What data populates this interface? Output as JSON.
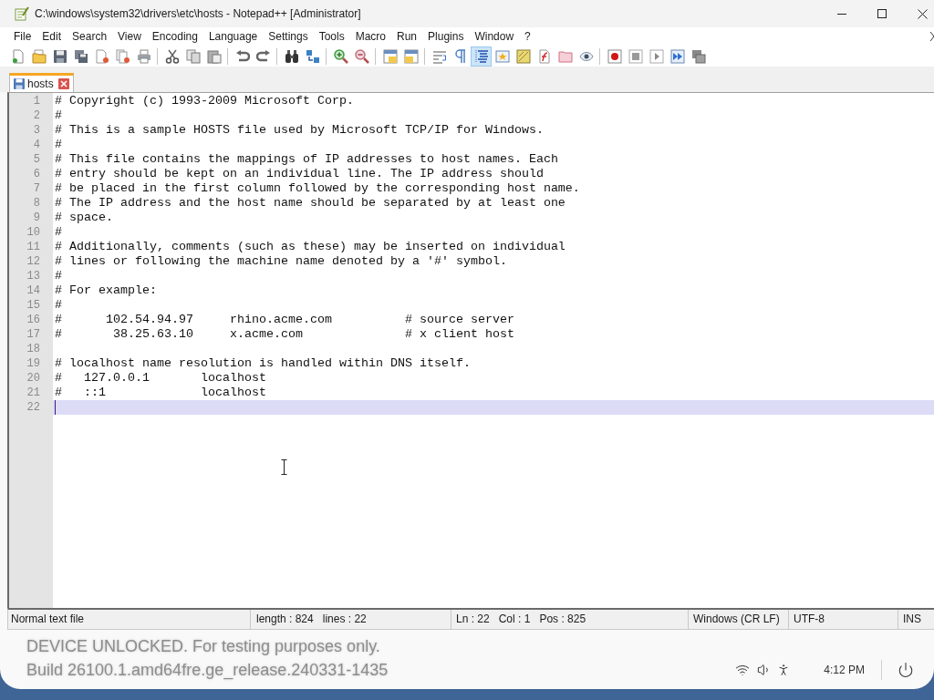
{
  "window": {
    "title": "C:\\windows\\system32\\drivers\\etc\\hosts - Notepad++ [Administrator]"
  },
  "menu": [
    "File",
    "Edit",
    "Search",
    "View",
    "Encoding",
    "Language",
    "Settings",
    "Tools",
    "Macro",
    "Run",
    "Plugins",
    "Window",
    "?"
  ],
  "toolbar": [
    {
      "buttons": [
        {
          "pressed": false
        },
        {
          "pressed": false
        },
        {
          "pressed": false
        },
        {
          "pressed": false
        },
        {
          "pressed": false
        },
        {
          "pressed": false
        },
        {
          "pressed": false
        }
      ]
    },
    {
      "buttons": [
        {
          "pressed": false
        },
        {
          "pressed": false
        },
        {
          "pressed": false
        }
      ]
    },
    {
      "buttons": [
        {
          "pressed": false
        },
        {
          "pressed": false
        }
      ]
    },
    {
      "buttons": [
        {
          "pressed": false
        },
        {
          "pressed": false
        }
      ]
    },
    {
      "buttons": [
        {
          "pressed": false
        },
        {
          "pressed": false
        }
      ]
    },
    {
      "buttons": [
        {
          "pressed": false
        },
        {
          "pressed": false
        }
      ]
    },
    {
      "buttons": [
        {
          "pressed": false
        },
        {
          "pressed": false
        },
        {
          "pressed": true
        },
        {
          "pressed": false
        },
        {
          "pressed": false
        },
        {
          "pressed": false
        },
        {
          "pressed": false
        },
        {
          "pressed": false
        }
      ]
    },
    {
      "buttons": [
        {
          "pressed": false
        },
        {
          "pressed": false
        },
        {
          "pressed": false
        },
        {
          "pressed": false
        },
        {
          "pressed": false
        }
      ]
    }
  ],
  "tabs": [
    {
      "label": "hosts",
      "selected": true,
      "saved": true
    }
  ],
  "editor": {
    "lines": [
      {
        "number": "1",
        "text": "# Copyright (c) 1993-2009 Microsoft Corp.",
        "current": false
      },
      {
        "number": "2",
        "text": "#",
        "current": false
      },
      {
        "number": "3",
        "text": "# This is a sample HOSTS file used by Microsoft TCP/IP for Windows.",
        "current": false
      },
      {
        "number": "4",
        "text": "#",
        "current": false
      },
      {
        "number": "5",
        "text": "# This file contains the mappings of IP addresses to host names. Each",
        "current": false
      },
      {
        "number": "6",
        "text": "# entry should be kept on an individual line. The IP address should",
        "current": false
      },
      {
        "number": "7",
        "text": "# be placed in the first column followed by the corresponding host name.",
        "current": false
      },
      {
        "number": "8",
        "text": "# The IP address and the host name should be separated by at least one",
        "current": false
      },
      {
        "number": "9",
        "text": "# space.",
        "current": false
      },
      {
        "number": "10",
        "text": "#",
        "current": false
      },
      {
        "number": "11",
        "text": "# Additionally, comments (such as these) may be inserted on individual",
        "current": false
      },
      {
        "number": "12",
        "text": "# lines or following the machine name denoted by a '#' symbol.",
        "current": false
      },
      {
        "number": "13",
        "text": "#",
        "current": false
      },
      {
        "number": "14",
        "text": "# For example:",
        "current": false
      },
      {
        "number": "15",
        "text": "#",
        "current": false
      },
      {
        "number": "16",
        "text": "#      102.54.94.97     rhino.acme.com          # source server",
        "current": false
      },
      {
        "number": "17",
        "text": "#       38.25.63.10     x.acme.com              # x client host",
        "current": false
      },
      {
        "number": "18",
        "current": false
      },
      {
        "number": "19",
        "text": "# localhost name resolution is handled within DNS itself.",
        "current": false
      },
      {
        "number": "20",
        "text": "#   127.0.0.1       localhost",
        "current": false
      },
      {
        "number": "21",
        "text": "#   ::1             localhost",
        "current": false
      },
      {
        "number": "22",
        "current": true
      }
    ]
  },
  "status_bar": {
    "doc_type": "Normal text file",
    "length": "length : 824",
    "lines": "lines : 22",
    "ln": "Ln : 22",
    "col": "Col : 1",
    "pos": "Pos : 825",
    "eol": "Windows (CR LF)",
    "encoding": "UTF-8",
    "mode": "INS"
  },
  "desktop": {
    "notice": [
      "DEVICE UNLOCKED. For testing purposes only.",
      "Build 26100.1.amd64fre.ge_release.240331-1435"
    ],
    "clock": "4:12 PM"
  }
}
